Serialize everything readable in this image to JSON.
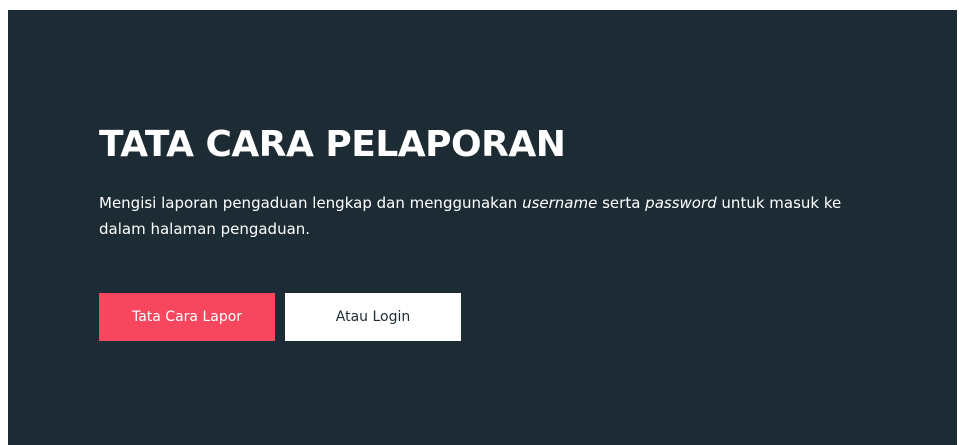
{
  "hero": {
    "title": "TATA CARA PELAPORAN",
    "description": {
      "part1": "Mengisi laporan pengaduan lengkap dan menggunakan ",
      "em1": "username",
      "part2": " serta ",
      "em2": "password",
      "part3": " untuk masuk ke dalam halaman pengaduan."
    },
    "buttons": {
      "primary_label": "Tata Cara Lapor",
      "secondary_label": "Atau Login"
    }
  },
  "colors": {
    "background": "#1d2c34",
    "accent": "#f6475f",
    "text": "#ffffff"
  }
}
